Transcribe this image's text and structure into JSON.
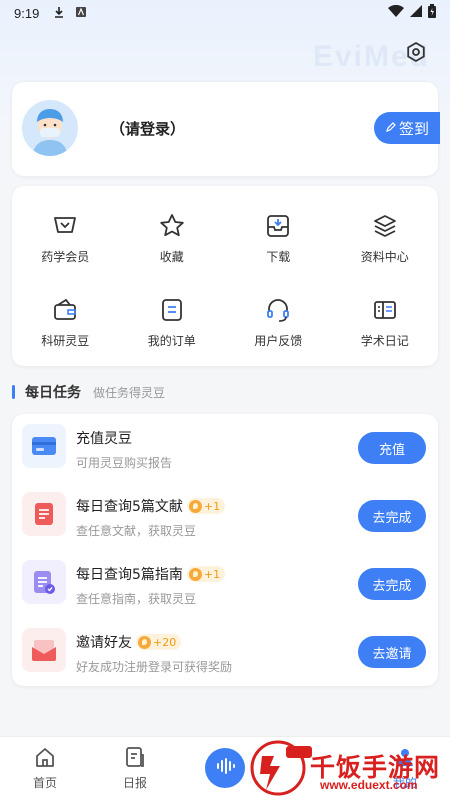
{
  "status": {
    "time": "9:19"
  },
  "header": {
    "watermark": "EviMed"
  },
  "profile": {
    "login_prompt": "（请登录）",
    "checkin_label": "签到"
  },
  "menu": {
    "items": [
      {
        "label": "药学会员",
        "icon": "vip-icon"
      },
      {
        "label": "收藏",
        "icon": "star-icon"
      },
      {
        "label": "下载",
        "icon": "download-icon"
      },
      {
        "label": "资料中心",
        "icon": "layers-icon"
      },
      {
        "label": "科研灵豆",
        "icon": "wallet-icon"
      },
      {
        "label": "我的订单",
        "icon": "order-icon"
      },
      {
        "label": "用户反馈",
        "icon": "headset-icon"
      },
      {
        "label": "学术日记",
        "icon": "diary-icon"
      }
    ]
  },
  "daily_tasks": {
    "title": "每日任务",
    "subtitle": "做任务得灵豆",
    "tasks": [
      {
        "title": "充值灵豆",
        "desc": "可用灵豆购买报告",
        "reward": "",
        "button": "充值"
      },
      {
        "title": "每日查询5篇文献",
        "desc": "查任意文献，获取灵豆",
        "reward": "+1",
        "button": "去完成"
      },
      {
        "title": "每日查询5篇指南",
        "desc": "查任意指南，获取灵豆",
        "reward": "+1",
        "button": "去完成"
      },
      {
        "title": "邀请好友",
        "desc": "好友成功注册登录可获得奖励",
        "reward": "+20",
        "button": "去邀请"
      }
    ]
  },
  "bottom_nav": {
    "items": [
      {
        "label": "首页",
        "icon": "home-icon"
      },
      {
        "label": "日报",
        "icon": "report-icon"
      },
      {
        "label": "",
        "icon": "voice-icon"
      },
      {
        "label": "",
        "icon": ""
      },
      {
        "label": "我的",
        "icon": "user-icon"
      }
    ]
  },
  "overlay_watermark": {
    "text": "千饭手游网",
    "url": "www.eduext.com"
  },
  "colors": {
    "accent": "#3e7ff6",
    "reward": "#f29b12",
    "watermark_red": "#d8201f"
  }
}
